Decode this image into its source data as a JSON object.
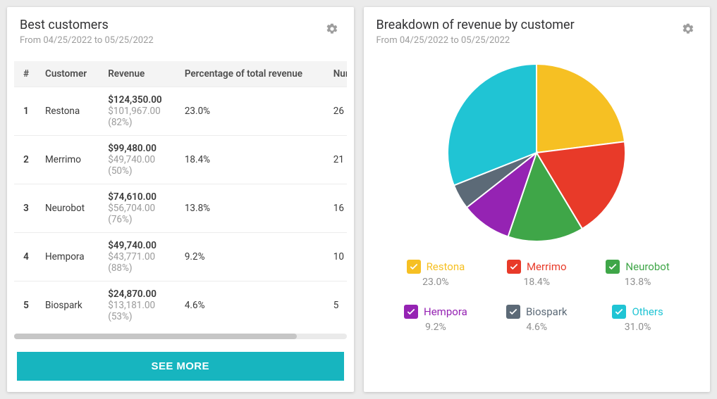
{
  "left": {
    "title": "Best customers",
    "subtitle": "From 04/25/2022 to 05/25/2022",
    "columns": {
      "rank": "#",
      "customer": "Customer",
      "revenue": "Revenue",
      "pct": "Percentage of total revenue",
      "orders": "Number"
    },
    "rows": [
      {
        "rank": "1",
        "customer": "Restona",
        "rev_main": "$124,350.00",
        "rev_sub": "$101,967.00",
        "rev_pct": "(82%)",
        "pct": "23.0%",
        "orders": "26"
      },
      {
        "rank": "2",
        "customer": "Merrimo",
        "rev_main": "$99,480.00",
        "rev_sub": "$49,740.00",
        "rev_pct": "(50%)",
        "pct": "18.4%",
        "orders": "21"
      },
      {
        "rank": "3",
        "customer": "Neurobot",
        "rev_main": "$74,610.00",
        "rev_sub": "$56,704.00",
        "rev_pct": "(76%)",
        "pct": "13.8%",
        "orders": "16"
      },
      {
        "rank": "4",
        "customer": "Hempora",
        "rev_main": "$49,740.00",
        "rev_sub": "$43,771.00",
        "rev_pct": "(88%)",
        "pct": "9.2%",
        "orders": "10"
      },
      {
        "rank": "5",
        "customer": "Biospark",
        "rev_main": "$24,870.00",
        "rev_sub": "$13,181.00",
        "rev_pct": "(53%)",
        "pct": "4.6%",
        "orders": "5"
      }
    ],
    "see_more": "SEE MORE"
  },
  "right": {
    "title": "Breakdown of revenue by customer",
    "subtitle": "From 04/25/2022 to 05/25/2022",
    "legend": [
      {
        "label": "Restona",
        "pct": "23.0%",
        "color": "#f6c023"
      },
      {
        "label": "Merrimo",
        "pct": "18.4%",
        "color": "#e83a29"
      },
      {
        "label": "Neurobot",
        "pct": "13.8%",
        "color": "#3fa648"
      },
      {
        "label": "Hempora",
        "pct": "9.2%",
        "color": "#9523b3"
      },
      {
        "label": "Biospark",
        "pct": "4.6%",
        "color": "#5c6a77"
      },
      {
        "label": "Others",
        "pct": "31.0%",
        "color": "#20c4d4"
      }
    ]
  },
  "chart_data": {
    "type": "pie",
    "title": "Breakdown of revenue by customer",
    "series": [
      {
        "name": "Restona",
        "value": 23.0,
        "color": "#f6c023"
      },
      {
        "name": "Merrimo",
        "value": 18.4,
        "color": "#e83a29"
      },
      {
        "name": "Neurobot",
        "value": 13.8,
        "color": "#3fa648"
      },
      {
        "name": "Hempora",
        "value": 9.2,
        "color": "#9523b3"
      },
      {
        "name": "Biospark",
        "value": 4.6,
        "color": "#5c6a77"
      },
      {
        "name": "Others",
        "value": 31.0,
        "color": "#20c4d4"
      }
    ]
  }
}
